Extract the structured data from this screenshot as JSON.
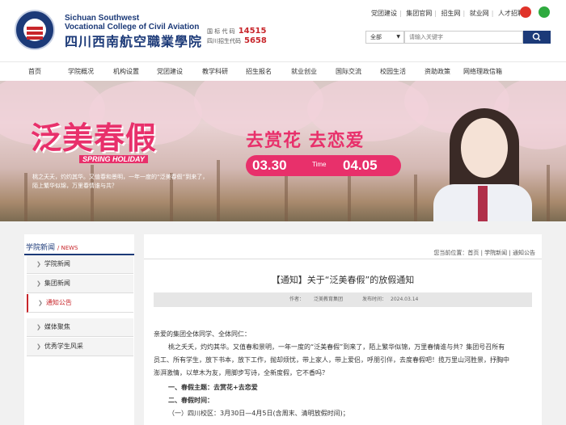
{
  "header": {
    "logo_en_line1": "Sichuan Southwest",
    "logo_en_line2": "Vocational College of Civil Aviation",
    "logo_cn": "四川西南航空職業學院",
    "code1_label": "国 标 代 码",
    "code1_value": "14515",
    "code2_label": "四川招生代码",
    "code2_value": "5658",
    "top_links": [
      "党团建设",
      "集团官网",
      "招生网",
      "就业网",
      "人才招聘"
    ],
    "search_scope": "全部",
    "search_placeholder": "请输入关键字"
  },
  "nav": {
    "items": [
      "首页",
      "学院概况",
      "机构设置",
      "党团建设",
      "教学科研",
      "招生报名",
      "就业创业",
      "国际交流",
      "校园生活",
      "资助政策",
      "网络理政信箱"
    ]
  },
  "banner": {
    "title": "泛美春假",
    "subtitle": "SPRING HOLIDAY",
    "desc_line1": "桃之夭夭，灼灼其华。又值春和景明，一年一度的“泛美春假”到来了，",
    "desc_line2": "陌上繁华似锦，万里春情谁与共？",
    "slogan": "去赏花 去恋爱",
    "date_start": "03.30",
    "date_mid": "Time",
    "date_end": "04.05"
  },
  "sidebar": {
    "title": "学院新闻",
    "title_en": "/ NEWS",
    "items": [
      {
        "label": "学院新闻",
        "active": false
      },
      {
        "label": "集团新闻",
        "active": false
      },
      {
        "label": "通知公告",
        "active": true
      },
      {
        "label": "媒体聚焦",
        "active": false
      },
      {
        "label": "优秀学生风采",
        "active": false
      }
    ]
  },
  "content": {
    "breadcrumb": "您当前位置：首页  |  学院新闻  |  通知公告",
    "title": "【通知】关于“泛美春假”的放假通知",
    "meta_author_label": "作者：",
    "meta_author": "泛美教育集团",
    "meta_date_label": "发布时间：",
    "meta_date": "2024.03.14",
    "greeting": "亲爱的集团全体同学、全体同仁：",
    "para_line1": "桃之夭夭，灼灼其华。又值春和景明，一年一度的“泛美春假”到来了，陌上繁华似锦，万里春情谁与共？集团号召所有",
    "para_line2": "员工、所有学生，放下书本，放下工作，抛却烦忧，带上家人，带上爱侣，呼朋引伴，去度春假吧！揽万里山河胜景，抒胸中",
    "para_line3": "澎湃激情，以草木为友，用脚步写诗，全新度假，它不香吗？",
    "h1": "一、春假主题：去赏花+去恋爱",
    "h2": "二、春假时间：",
    "item1": "（一）四川校区：3月30日—4月5日(含周末、清明放假时间)；"
  },
  "colors": {
    "brand_navy": "#1c3a78",
    "accent_red": "#c8262b",
    "banner_pink": "#e8306b"
  }
}
